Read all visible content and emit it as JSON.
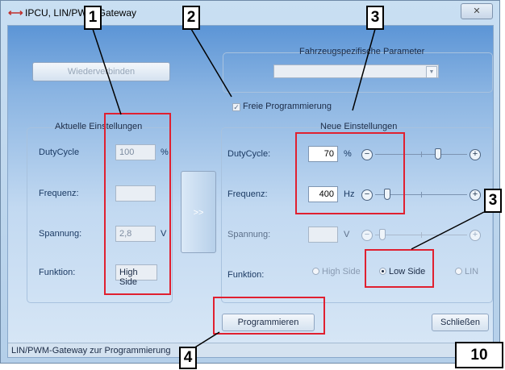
{
  "window": {
    "title": "IPCU, LIN/PWM-Gateway",
    "close_label": "✕"
  },
  "top": {
    "reconnect_label": "Wiederverbinden",
    "vehicle_params_legend": "Fahrzeugspezifische Parameter",
    "vehicle_params_value": "",
    "free_programming_label": "Freie Programmierung",
    "free_programming_checked": true
  },
  "current": {
    "legend": "Aktuelle Einstellungen",
    "rows": [
      {
        "label": "DutyCycle",
        "value": "100",
        "unit": "%"
      },
      {
        "label": "Frequenz:",
        "value": "",
        "unit": ""
      },
      {
        "label": "Spannung:",
        "value": "2,8",
        "unit": "V"
      },
      {
        "label": "Funktion:",
        "value": "High Side",
        "unit": ""
      }
    ]
  },
  "transfer_label": ">>",
  "new": {
    "legend": "Neue Einstellungen",
    "duty": {
      "label": "DutyCycle:",
      "value": "70",
      "unit": "%",
      "slider_fraction": 0.7
    },
    "freq": {
      "label": "Frequenz:",
      "value": "400",
      "unit": "Hz",
      "slider_fraction": 0.1
    },
    "volt": {
      "label": "Spannung:",
      "value": "",
      "unit": "V",
      "slider_fraction": 0.05
    },
    "function": {
      "label": "Funktion:",
      "options": [
        "High Side",
        "Low Side",
        "LIN"
      ],
      "selected": "Low Side"
    }
  },
  "buttons": {
    "program": "Programmieren",
    "close": "Schließen"
  },
  "status": "LIN/PWM-Gateway zur Programmierung",
  "callouts": {
    "c1": "1",
    "c2": "2",
    "c3a": "3",
    "c3b": "3",
    "c4": "4"
  },
  "page_number": "10",
  "colors": {
    "highlight": "#e02030",
    "title_icon": "#c0302e"
  }
}
